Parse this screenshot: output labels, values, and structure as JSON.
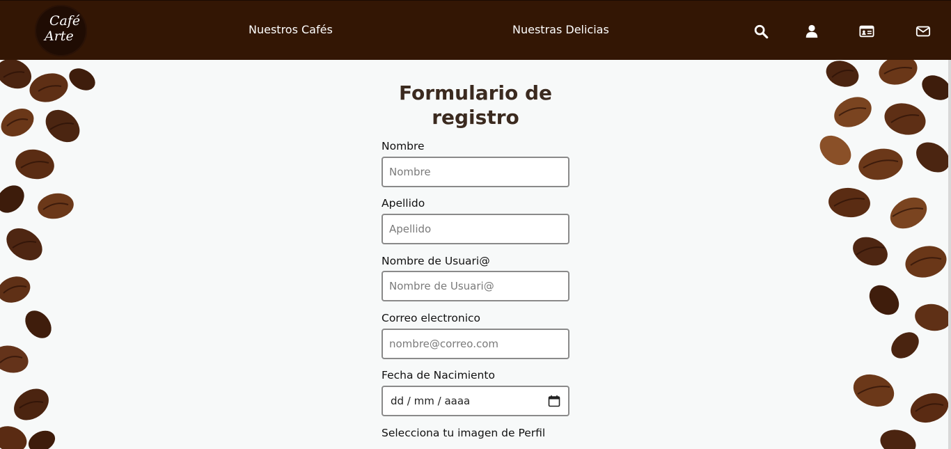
{
  "header": {
    "logo": {
      "line1": "Café",
      "line2": "Arte"
    },
    "nav": [
      {
        "label": "Nuestros Cafés"
      },
      {
        "label": "Nuestras Delicias"
      }
    ],
    "icons": [
      "search-icon",
      "user-icon",
      "id-card-icon",
      "envelope-icon"
    ],
    "background_color": "#331604"
  },
  "form": {
    "title": "Formulario de registro",
    "fields": [
      {
        "label": "Nombre",
        "placeholder": "Nombre",
        "value": ""
      },
      {
        "label": "Apellido",
        "placeholder": "Apellido",
        "value": ""
      },
      {
        "label": "Nombre de Usuari@",
        "placeholder": "Nombre de Usuari@",
        "value": ""
      },
      {
        "label": "Correo electronico",
        "placeholder": "nombre@correo.com",
        "value": ""
      }
    ],
    "birthdate": {
      "label": "Fecha de Nacimiento",
      "format": "dd / mm / aaaa"
    },
    "profile_image": {
      "label": "Selecciona tu imagen de Perfil"
    },
    "title_color": "#3b2a1f"
  }
}
